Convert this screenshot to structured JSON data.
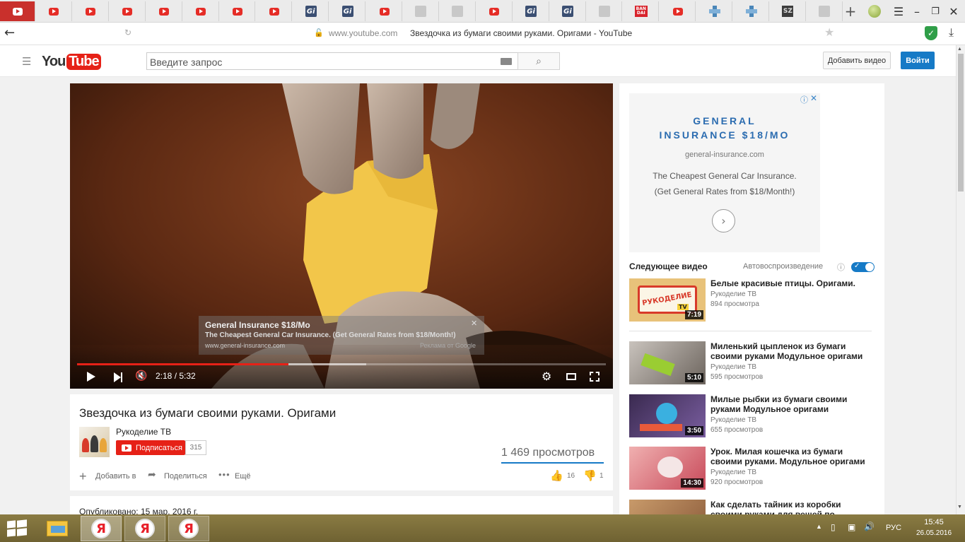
{
  "browser": {
    "tabs": [
      {
        "icon": "youtube-icon",
        "active": true
      },
      {
        "icon": "youtube-icon"
      },
      {
        "icon": "youtube-icon"
      },
      {
        "icon": "youtube-icon"
      },
      {
        "icon": "youtube-icon"
      },
      {
        "icon": "youtube-icon"
      },
      {
        "icon": "youtube-icon"
      },
      {
        "icon": "youtube-icon"
      },
      {
        "icon": "gi-icon",
        "text": "Gi"
      },
      {
        "icon": "gi-icon",
        "text": "Gi"
      },
      {
        "icon": "youtube-icon"
      },
      {
        "icon": "blank-page-icon"
      },
      {
        "icon": "blank-page-icon"
      },
      {
        "icon": "youtube-icon"
      },
      {
        "icon": "gi-icon",
        "text": "Gi"
      },
      {
        "icon": "gi-icon",
        "text": "Gi"
      },
      {
        "icon": "blank-page-icon"
      },
      {
        "icon": "bandai-icon",
        "text": "BAN DAI"
      },
      {
        "icon": "youtube-icon"
      },
      {
        "icon": "cross-icon"
      },
      {
        "icon": "cross-icon"
      },
      {
        "icon": "sz-icon",
        "text": "SZ"
      },
      {
        "icon": "blank-page-icon"
      }
    ],
    "new_tab": "+",
    "url_domain": "www.youtube.com",
    "page_title": "Звездочка из бумаги своими руками. Оригами - YouTube"
  },
  "yt": {
    "logo_you": "You",
    "logo_tube": "Tube",
    "search_placeholder": "Введите запрос",
    "upload_label": "Добавить видео",
    "signin_label": "Войти"
  },
  "player": {
    "time": "2:18 / 5:32",
    "progress_played": 0.4,
    "progress_buffered": 0.547,
    "ad_overlay": {
      "title": "General Insurance $18/Mo",
      "text": "The Cheapest General Car Insurance. (Get General Rates from $18/Month!)",
      "url": "www.general-insurance.com",
      "by": "Реклама от Google",
      "close": "✕"
    }
  },
  "video": {
    "title": "Звездочка из бумаги своими руками. Оригами",
    "channel": "Рукоделие ТВ",
    "subscribe_label": "Подписаться",
    "subscriber_count": "315",
    "views": "1 469 просмотров",
    "add_to": "Добавить в",
    "share": "Поделиться",
    "more": "Ещё",
    "likes": "16",
    "dislikes": "1",
    "published": "Опубликовано: 15 мар. 2016 г."
  },
  "ad": {
    "headline_1": "GENERAL",
    "headline_2": "INSURANCE $18/MO",
    "domain": "general-insurance.com",
    "line1": "The Cheapest General Car Insurance.",
    "line2": "(Get General Rates from $18/Month!)"
  },
  "sidebar": {
    "up_next": "Следующее видео",
    "autoplay": "Автовоспроизведение",
    "autoplay_on": true,
    "videos": [
      {
        "title": "Белые красивые птицы. Оригами.",
        "channel": "Рукоделие ТВ",
        "views": "894 просмотра",
        "duration": "7:19",
        "thumb_label": "РУКОДЕЛИЕ",
        "thumb_tv": "TV"
      },
      {
        "title": "Миленький цыпленок из бумаги своими руками Модульное оригами",
        "channel": "Рукоделие ТВ",
        "views": "595 просмотров",
        "duration": "5:10"
      },
      {
        "title": "Милые рыбки из бумаги своими руками Модульное оригами",
        "channel": "Рукоделие ТВ",
        "views": "655 просмотров",
        "duration": "3:50"
      },
      {
        "title": "Урок. Милая кошечка из бумаги своими руками. Модульное оригами",
        "channel": "Рукоделие ТВ",
        "views": "920 просмотров",
        "duration": "14:30"
      },
      {
        "title": "Как сделать тайник из коробки своими руками для вещей по рукоделию",
        "channel": "",
        "views": "",
        "duration": ""
      }
    ]
  },
  "taskbar": {
    "language": "РУС",
    "time": "15:45",
    "date": "26.05.2016",
    "yandex_letter": "Я"
  },
  "colors": {
    "yt_red": "#e62117",
    "accent_blue": "#167ac6",
    "tab_active": "#c9302c",
    "taskbar": "#7a6c3a"
  }
}
